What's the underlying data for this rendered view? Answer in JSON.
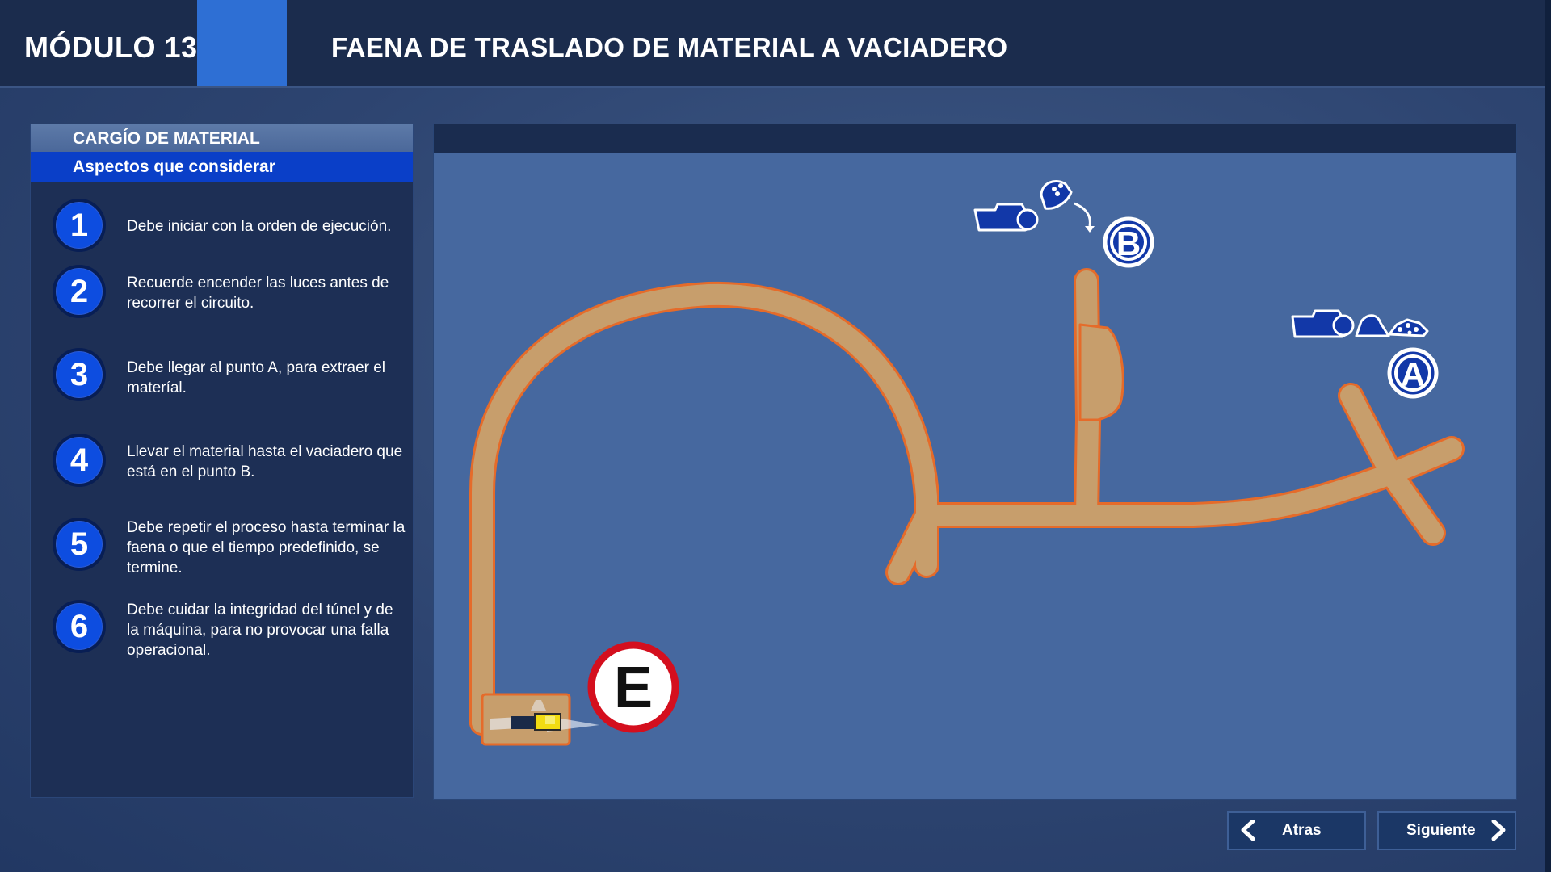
{
  "header": {
    "module": "MÓDULO 13",
    "title": "FAENA DE TRASLADO DE MATERIAL A VACIADERO"
  },
  "panel": {
    "heading": "CARGÍO DE MATERIAL",
    "subheading": "Aspectos que considerar",
    "steps": [
      {
        "num": "1",
        "text": "Debe iniciar con la orden de ejecución."
      },
      {
        "num": "2",
        "text": "Recuerde encender las luces antes de recorrer el circuito."
      },
      {
        "num": "3",
        "text": "Debe llegar al punto A, para extraer el materíal."
      },
      {
        "num": "4",
        "text": "Llevar el material hasta el vaciadero que está en el punto B."
      },
      {
        "num": "5",
        "text": "Debe repetir el proceso hasta terminar la faena o que el tiempo predefinido, se termine."
      },
      {
        "num": "6",
        "text": "Debe cuidar la integridad del túnel y de la máquina, para no provocar una falla operacional."
      }
    ]
  },
  "map": {
    "marker_a": "A",
    "marker_b": "B",
    "marker_e": "E"
  },
  "nav": {
    "back": "Atras",
    "next": "Siguiente"
  },
  "colors": {
    "header_bg": "#1b2c4d",
    "accent_blue": "#2e6fd4",
    "tunnel_fill": "#c79e6c",
    "tunnel_edge": "#e56b2a",
    "marker_blue": "#1238a8",
    "stop_red": "#d40f1e"
  }
}
